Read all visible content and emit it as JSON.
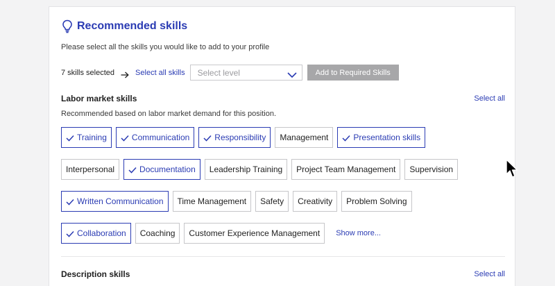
{
  "header": {
    "title": "Recommended skills",
    "subtitle": "Please select all the skills you would like to add to your profile"
  },
  "selection": {
    "count_text": "7 skills selected",
    "select_all": "Select all skills",
    "level_placeholder": "Select level",
    "add_button": "Add to Required Skills"
  },
  "labor_market": {
    "title": "Labor market skills",
    "select_all": "Select all",
    "description": "Recommended based on labor market demand for this position.",
    "rows": [
      [
        {
          "label": "Training",
          "selected": true
        },
        {
          "label": "Communication",
          "selected": true
        },
        {
          "label": "Responsibility",
          "selected": true
        },
        {
          "label": "Management",
          "selected": false
        },
        {
          "label": "Presentation skills",
          "selected": true
        }
      ],
      [
        {
          "label": "Interpersonal",
          "selected": false
        },
        {
          "label": "Documentation",
          "selected": true
        },
        {
          "label": "Leadership Training",
          "selected": false
        },
        {
          "label": "Project Team Management",
          "selected": false
        },
        {
          "label": "Supervision",
          "selected": false
        }
      ],
      [
        {
          "label": "Written Communication",
          "selected": true
        },
        {
          "label": "Time Management",
          "selected": false
        },
        {
          "label": "Safety",
          "selected": false
        },
        {
          "label": "Creativity",
          "selected": false
        },
        {
          "label": "Problem Solving",
          "selected": false
        }
      ],
      [
        {
          "label": "Collaboration",
          "selected": true
        },
        {
          "label": "Coaching",
          "selected": false
        },
        {
          "label": "Customer Experience Management",
          "selected": false
        }
      ]
    ],
    "show_more": "Show more..."
  },
  "description_skills": {
    "title": "Description skills",
    "select_all": "Select all"
  },
  "colors": {
    "accent": "#2a3bb3",
    "button_disabled": "#a7a7a9",
    "background": "#f3f3f4"
  },
  "icons": {
    "title": "lightbulb-icon",
    "arrow": "arrow-right-icon",
    "dropdown": "chevron-down-icon",
    "check": "check-icon",
    "pointer": "mouse-cursor-icon"
  }
}
